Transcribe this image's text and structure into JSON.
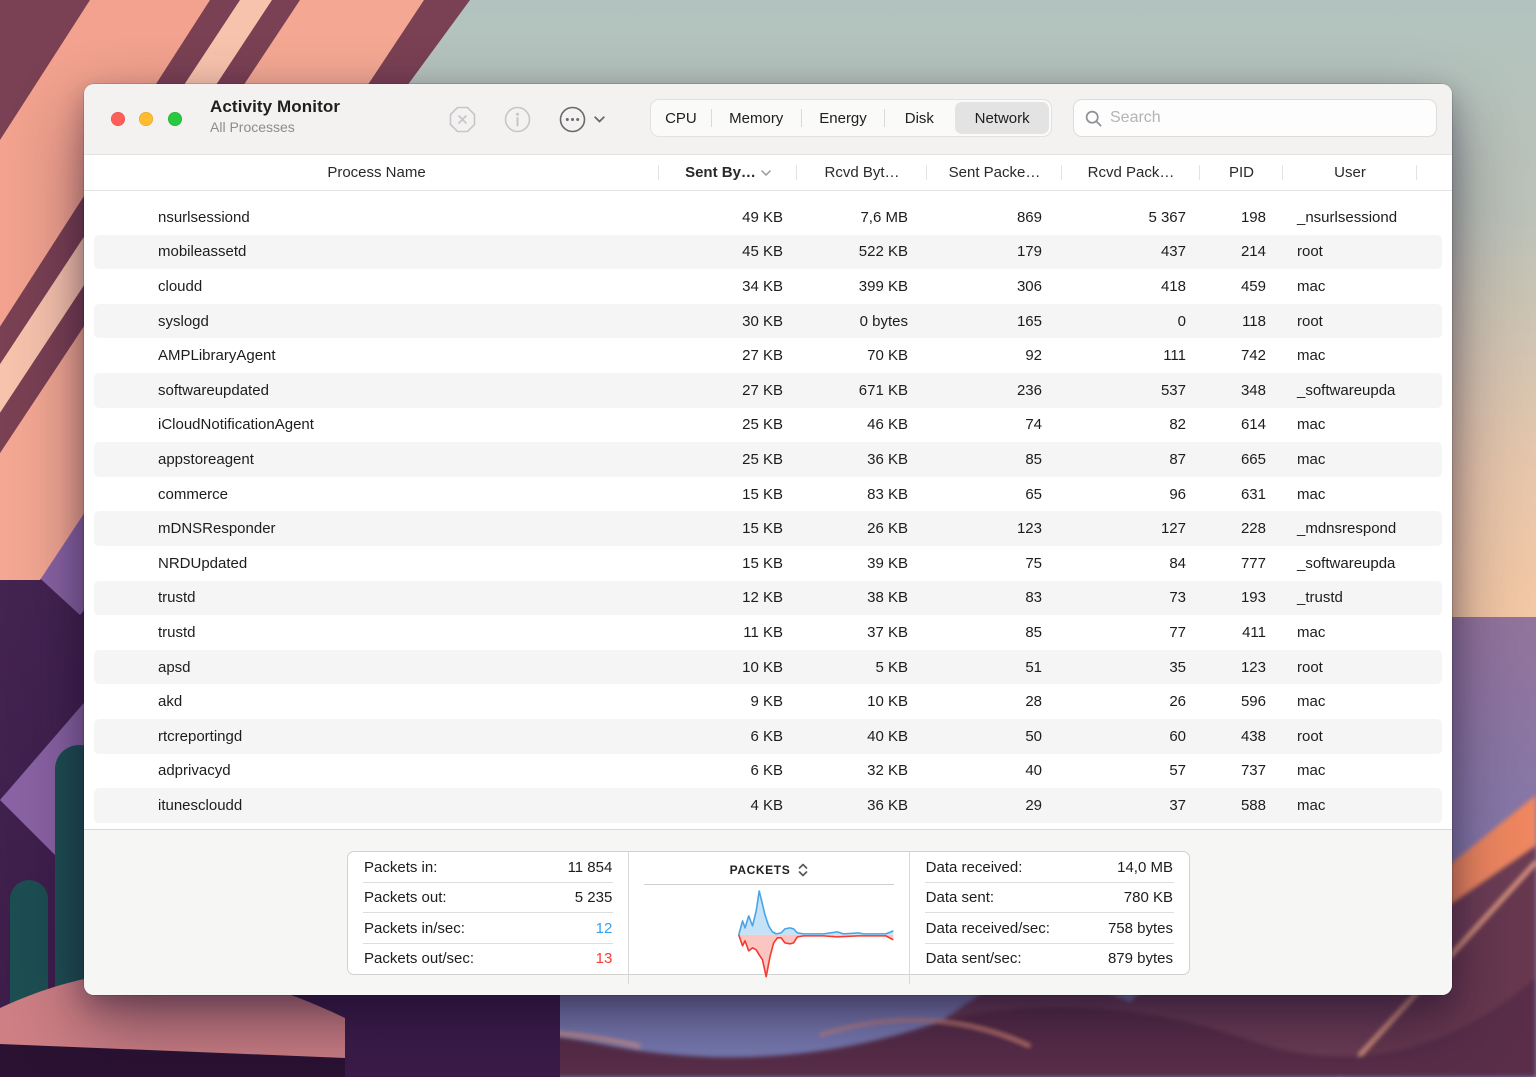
{
  "window": {
    "title": "Activity Monitor",
    "subtitle": "All Processes"
  },
  "toolbar": {
    "quit_button": "quit-process",
    "inspect_button": "inspect-process",
    "more_button": "more-options",
    "tabs": [
      "CPU",
      "Memory",
      "Energy",
      "Disk",
      "Network"
    ],
    "selected_tab": "Network",
    "search_placeholder": "Search"
  },
  "table": {
    "columns": [
      {
        "label": "Process Name"
      },
      {
        "label": "Sent By…",
        "sorted": true,
        "sort_direction": "desc"
      },
      {
        "label": "Rcvd Byt…"
      },
      {
        "label": "Sent Packe…"
      },
      {
        "label": "Rcvd Pack…"
      },
      {
        "label": "PID"
      },
      {
        "label": "User"
      }
    ],
    "rows": [
      {
        "name": "nsurlsessiond",
        "sent_bytes": "49 KB",
        "rcvd_bytes": "7,6 MB",
        "sent_packets": "869",
        "rcvd_packets": "5 367",
        "pid": "198",
        "user": "_nsurlsessiond"
      },
      {
        "name": "mobileassetd",
        "sent_bytes": "45 KB",
        "rcvd_bytes": "522 KB",
        "sent_packets": "179",
        "rcvd_packets": "437",
        "pid": "214",
        "user": "root"
      },
      {
        "name": "cloudd",
        "sent_bytes": "34 KB",
        "rcvd_bytes": "399 KB",
        "sent_packets": "306",
        "rcvd_packets": "418",
        "pid": "459",
        "user": "mac"
      },
      {
        "name": "syslogd",
        "sent_bytes": "30 KB",
        "rcvd_bytes": "0 bytes",
        "sent_packets": "165",
        "rcvd_packets": "0",
        "pid": "118",
        "user": "root"
      },
      {
        "name": "AMPLibraryAgent",
        "sent_bytes": "27 KB",
        "rcvd_bytes": "70 KB",
        "sent_packets": "92",
        "rcvd_packets": "111",
        "pid": "742",
        "user": "mac"
      },
      {
        "name": "softwareupdated",
        "sent_bytes": "27 KB",
        "rcvd_bytes": "671 KB",
        "sent_packets": "236",
        "rcvd_packets": "537",
        "pid": "348",
        "user": "_softwareupda"
      },
      {
        "name": "iCloudNotificationAgent",
        "sent_bytes": "25 KB",
        "rcvd_bytes": "46 KB",
        "sent_packets": "74",
        "rcvd_packets": "82",
        "pid": "614",
        "user": "mac"
      },
      {
        "name": "appstoreagent",
        "sent_bytes": "25 KB",
        "rcvd_bytes": "36 KB",
        "sent_packets": "85",
        "rcvd_packets": "87",
        "pid": "665",
        "user": "mac"
      },
      {
        "name": "commerce",
        "sent_bytes": "15 KB",
        "rcvd_bytes": "83 KB",
        "sent_packets": "65",
        "rcvd_packets": "96",
        "pid": "631",
        "user": "mac"
      },
      {
        "name": "mDNSResponder",
        "sent_bytes": "15 KB",
        "rcvd_bytes": "26 KB",
        "sent_packets": "123",
        "rcvd_packets": "127",
        "pid": "228",
        "user": "_mdnsrespond"
      },
      {
        "name": "NRDUpdated",
        "sent_bytes": "15 KB",
        "rcvd_bytes": "39 KB",
        "sent_packets": "75",
        "rcvd_packets": "84",
        "pid": "777",
        "user": "_softwareupda"
      },
      {
        "name": "trustd",
        "sent_bytes": "12 KB",
        "rcvd_bytes": "38 KB",
        "sent_packets": "83",
        "rcvd_packets": "73",
        "pid": "193",
        "user": "_trustd"
      },
      {
        "name": "trustd",
        "sent_bytes": "11 KB",
        "rcvd_bytes": "37 KB",
        "sent_packets": "85",
        "rcvd_packets": "77",
        "pid": "411",
        "user": "mac"
      },
      {
        "name": "apsd",
        "sent_bytes": "10 KB",
        "rcvd_bytes": "5 KB",
        "sent_packets": "51",
        "rcvd_packets": "35",
        "pid": "123",
        "user": "root"
      },
      {
        "name": "akd",
        "sent_bytes": "9 KB",
        "rcvd_bytes": "10 KB",
        "sent_packets": "28",
        "rcvd_packets": "26",
        "pid": "596",
        "user": "mac"
      },
      {
        "name": "rtcreportingd",
        "sent_bytes": "6 KB",
        "rcvd_bytes": "40 KB",
        "sent_packets": "50",
        "rcvd_packets": "60",
        "pid": "438",
        "user": "root"
      },
      {
        "name": "adprivacyd",
        "sent_bytes": "6 KB",
        "rcvd_bytes": "32 KB",
        "sent_packets": "40",
        "rcvd_packets": "57",
        "pid": "737",
        "user": "mac"
      },
      {
        "name": "itunescloudd",
        "sent_bytes": "4 KB",
        "rcvd_bytes": "36 KB",
        "sent_packets": "29",
        "rcvd_packets": "37",
        "pid": "588",
        "user": "mac"
      }
    ]
  },
  "bottom_panel": {
    "left_stats": [
      {
        "label": "Packets in:",
        "value": "11 854"
      },
      {
        "label": "Packets out:",
        "value": "5 235"
      },
      {
        "label": "Packets in/sec:",
        "value": "12",
        "color": "blue"
      },
      {
        "label": "Packets out/sec:",
        "value": "13",
        "color": "red"
      }
    ],
    "right_stats": [
      {
        "label": "Data received:",
        "value": "14,0 MB"
      },
      {
        "label": "Data sent:",
        "value": "780 KB"
      },
      {
        "label": "Data received/sec:",
        "value": "758 bytes"
      },
      {
        "label": "Data sent/sec:",
        "value": "879 bytes"
      }
    ],
    "chart": {
      "type": "area",
      "title": "PACKETS",
      "baseline": 49,
      "series": [
        {
          "name": "packets in",
          "color": "#49a3e9",
          "fill": "#c5e2f7",
          "points": [
            [
              0.38,
              0
            ],
            [
              0.395,
              14
            ],
            [
              0.405,
              7
            ],
            [
              0.42,
              19
            ],
            [
              0.435,
              9
            ],
            [
              0.45,
              24
            ],
            [
              0.462,
              44
            ],
            [
              0.472,
              34
            ],
            [
              0.485,
              20
            ],
            [
              0.5,
              9
            ],
            [
              0.515,
              3
            ],
            [
              0.53,
              1
            ],
            [
              0.55,
              2
            ],
            [
              0.565,
              6
            ],
            [
              0.585,
              7
            ],
            [
              0.6,
              6
            ],
            [
              0.615,
              2
            ],
            [
              0.64,
              1
            ],
            [
              0.72,
              1
            ],
            [
              0.775,
              3
            ],
            [
              0.8,
              1
            ],
            [
              0.86,
              2
            ],
            [
              0.88,
              1
            ],
            [
              0.97,
              1
            ],
            [
              1.0,
              4
            ]
          ]
        },
        {
          "name": "packets out",
          "color": "#f5392e",
          "fill": "#fbc6c1",
          "points": [
            [
              0.38,
              0
            ],
            [
              0.395,
              11
            ],
            [
              0.405,
              6
            ],
            [
              0.42,
              16
            ],
            [
              0.435,
              13
            ],
            [
              0.45,
              15
            ],
            [
              0.462,
              20
            ],
            [
              0.475,
              25
            ],
            [
              0.49,
              42
            ],
            [
              0.505,
              22
            ],
            [
              0.52,
              8
            ],
            [
              0.535,
              3
            ],
            [
              0.55,
              3
            ],
            [
              0.565,
              8
            ],
            [
              0.585,
              9
            ],
            [
              0.6,
              8
            ],
            [
              0.615,
              2
            ],
            [
              0.64,
              1
            ],
            [
              0.72,
              1
            ],
            [
              0.775,
              2
            ],
            [
              0.86,
              1
            ],
            [
              0.97,
              1
            ],
            [
              1.0,
              5
            ]
          ]
        }
      ]
    }
  },
  "colors": {
    "accent_blue": "#3aa0e8",
    "accent_red": "#fd3b30",
    "traffic_red": "#ff5f57",
    "traffic_yellow": "#febc2e",
    "traffic_green": "#28c840",
    "selected_tab_bg": "#e4e3e3"
  }
}
